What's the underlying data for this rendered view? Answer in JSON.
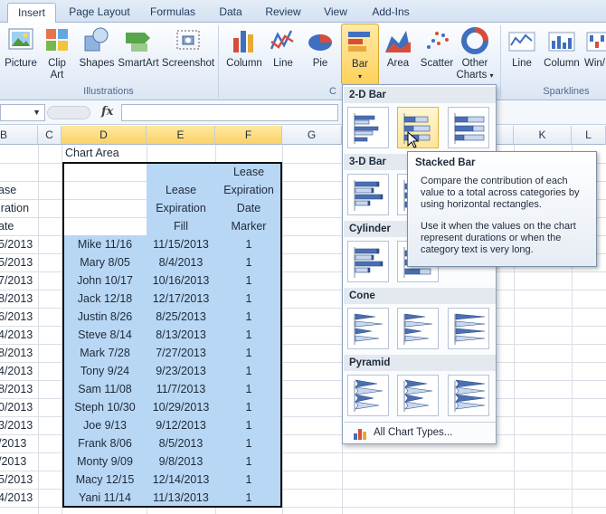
{
  "ribbon": {
    "tabs": [
      "Insert",
      "Page Layout",
      "Formulas",
      "Data",
      "Review",
      "View",
      "Add-Ins"
    ],
    "active_tab": "Insert",
    "buttons": {
      "picture": "Picture",
      "clip_art_1": "Clip",
      "clip_art_2": "Art",
      "shapes": "Shapes",
      "smartart": "SmartArt",
      "screenshot": "Screenshot",
      "column": "Column",
      "line": "Line",
      "pie": "Pie",
      "bar": "Bar",
      "area": "Area",
      "scatter": "Scatter",
      "other_charts_1": "Other",
      "other_charts_2": "Charts",
      "sparkline_line": "Line",
      "sparkline_column": "Column",
      "sparkline_winloss": "Win/"
    },
    "groups": {
      "illustrations": "Illustrations",
      "charts_partial": "C",
      "sparklines": "Sparklines"
    }
  },
  "formula_bar": {
    "fx": "fx"
  },
  "columns": [
    "B",
    "C",
    "D",
    "E",
    "F",
    "G",
    "K",
    "L"
  ],
  "sheet": {
    "chart_area_label": "Chart Area",
    "col_b_partial": [
      "ase",
      "iration",
      "ate",
      "5/2013",
      "5/2013",
      "7/2013",
      "8/2013",
      "6/2013",
      "4/2013",
      "8/2013",
      "4/2013",
      "8/2013",
      "0/2013",
      "3/2013",
      "/2013",
      "/2013",
      "5/2013",
      "4/2013"
    ],
    "headers": {
      "e": [
        "Lease",
        "Expiration",
        "Fill"
      ],
      "f": [
        "Lease",
        "Expiration",
        "Date",
        "Marker"
      ]
    },
    "rows": [
      {
        "d": "Mike 11/16",
        "e": "11/15/2013",
        "f": "1"
      },
      {
        "d": "Mary 8/05",
        "e": "8/4/2013",
        "f": "1"
      },
      {
        "d": "John 10/17",
        "e": "10/16/2013",
        "f": "1"
      },
      {
        "d": "Jack 12/18",
        "e": "12/17/2013",
        "f": "1"
      },
      {
        "d": "Justin 8/26",
        "e": "8/25/2013",
        "f": "1"
      },
      {
        "d": "Steve 8/14",
        "e": "8/13/2013",
        "f": "1"
      },
      {
        "d": "Mark 7/28",
        "e": "7/27/2013",
        "f": "1"
      },
      {
        "d": "Tony 9/24",
        "e": "9/23/2013",
        "f": "1"
      },
      {
        "d": "Sam 11/08",
        "e": "11/7/2013",
        "f": "1"
      },
      {
        "d": "Steph 10/30",
        "e": "10/29/2013",
        "f": "1"
      },
      {
        "d": "Joe 9/13",
        "e": "9/12/2013",
        "f": "1"
      },
      {
        "d": "Frank 8/06",
        "e": "8/5/2013",
        "f": "1"
      },
      {
        "d": "Monty 9/09",
        "e": "9/8/2013",
        "f": "1"
      },
      {
        "d": "Macy 12/15",
        "e": "12/14/2013",
        "f": "1"
      },
      {
        "d": "Yani 11/14",
        "e": "11/13/2013",
        "f": "1"
      }
    ]
  },
  "dropdown": {
    "sections": [
      "2-D Bar",
      "3-D Bar",
      "Cylinder",
      "Cone",
      "Pyramid"
    ],
    "all_chart_types": "All Chart Types..."
  },
  "tooltip": {
    "title": "Stacked Bar",
    "body1": "Compare the contribution of each value to a total across categories by using horizontal rectangles.",
    "body2": "Use it when the values on the chart represent durations or when the category text is very long."
  },
  "colors": {
    "selection": "#b8d7f4",
    "accent": "#ffd15a",
    "chart_blue": "#4a6fb4"
  }
}
